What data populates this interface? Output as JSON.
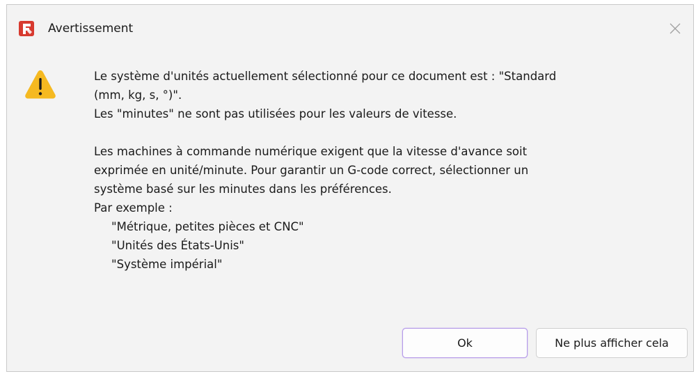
{
  "window": {
    "title": "Avertissement",
    "app_icon": "freecad-app-icon",
    "close_icon": "close-icon",
    "brand_color": "#d73a2f",
    "accent_color": "#b69ce8"
  },
  "message": {
    "icon": "warning-icon",
    "icon_color": "#f5b921",
    "paragraph1": [
      "Le système d'unités actuellement sélectionné pour ce document est : \"Standard",
      "(mm, kg, s, °)\".",
      "Les \"minutes\" ne sont pas utilisées pour les valeurs de vitesse."
    ],
    "paragraph2": [
      "Les machines à commande numérique exigent que la vitesse d'avance soit",
      "exprimée en unité/minute. Pour garantir un G-code correct, sélectionner un",
      "système basé sur les minutes dans les préférences.",
      "Par exemple :"
    ],
    "examples": [
      "\"Métrique, petites pièces et CNC\"",
      "\"Unités des États-Unis\"",
      "\"Système impérial\""
    ]
  },
  "buttons": {
    "ok_label": "Ok",
    "dont_show_label": "Ne plus afficher cela"
  }
}
